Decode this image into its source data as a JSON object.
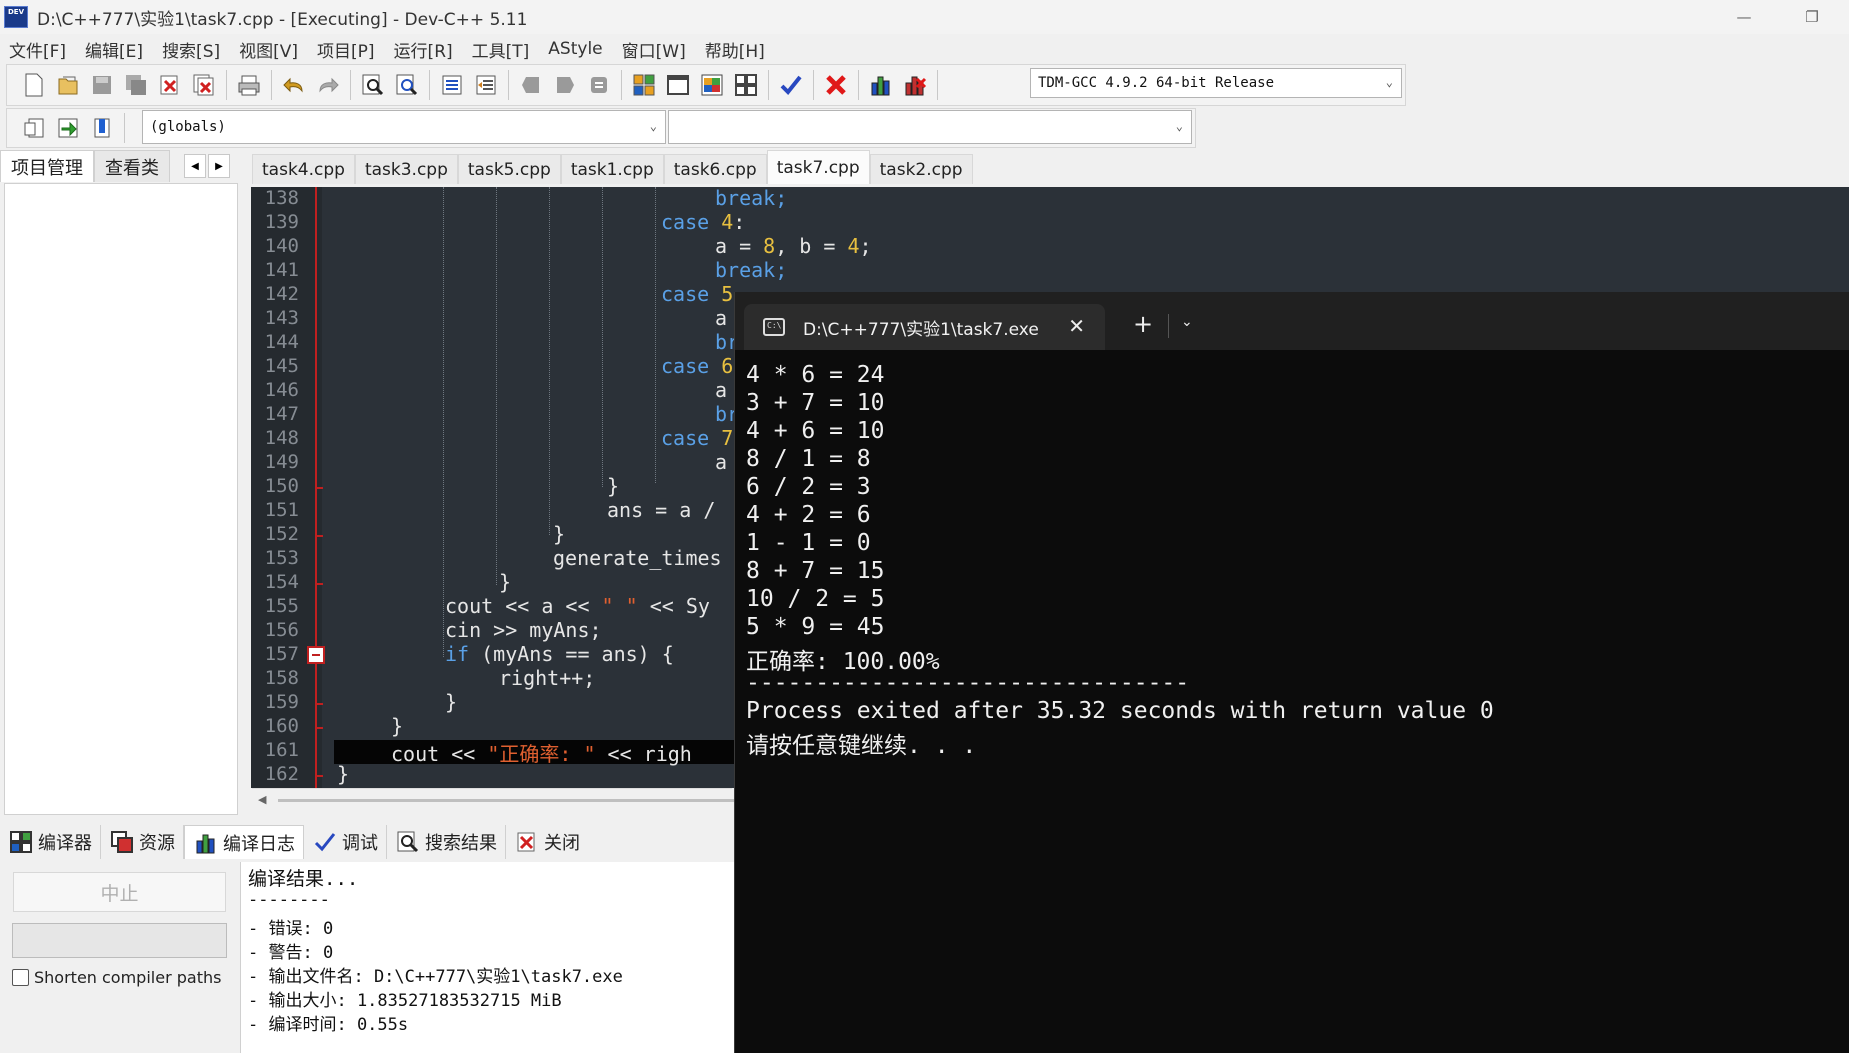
{
  "window": {
    "title": "D:\\C++777\\实验1\\task7.cpp - [Executing] - Dev-C++ 5.11",
    "app_icon_text": "DEV"
  },
  "menu": [
    "文件[F]",
    "编辑[E]",
    "搜索[S]",
    "视图[V]",
    "项目[P]",
    "运行[R]",
    "工具[T]",
    "AStyle",
    "窗口[W]",
    "帮助[H]"
  ],
  "toolbar": {
    "compiler_select": "TDM-GCC 4.9.2 64-bit Release",
    "scope_select": "(globals)",
    "symbol_select": ""
  },
  "left_panel": {
    "tabs": [
      "项目管理",
      "查看类"
    ]
  },
  "editor_tabs": [
    "task4.cpp",
    "task3.cpp",
    "task5.cpp",
    "task1.cpp",
    "task6.cpp",
    "task7.cpp",
    "task2.cpp"
  ],
  "active_editor_tab": "task7.cpp",
  "code_lines": [
    {
      "n": "138",
      "text": "break;"
    },
    {
      "n": "139",
      "text": "case 4:"
    },
    {
      "n": "140",
      "text": "a = 8, b = 4;"
    },
    {
      "n": "141",
      "text": "break;"
    },
    {
      "n": "142",
      "text": "case 5"
    },
    {
      "n": "143",
      "text": "a"
    },
    {
      "n": "144",
      "text": "br"
    },
    {
      "n": "145",
      "text": "case 6"
    },
    {
      "n": "146",
      "text": "a"
    },
    {
      "n": "147",
      "text": "br"
    },
    {
      "n": "148",
      "text": "case 7"
    },
    {
      "n": "149",
      "text": "a"
    },
    {
      "n": "150",
      "text": "}"
    },
    {
      "n": "151",
      "text": "ans = a /"
    },
    {
      "n": "152",
      "text": "}"
    },
    {
      "n": "153",
      "text": "generate_times"
    },
    {
      "n": "154",
      "text": "}"
    },
    {
      "n": "155",
      "text": "cout << a << \" \" << Sy"
    },
    {
      "n": "156",
      "text": "cin >> myAns;"
    },
    {
      "n": "157",
      "text": "if (myAns == ans) {"
    },
    {
      "n": "158",
      "text": "right++;"
    },
    {
      "n": "159",
      "text": "}"
    },
    {
      "n": "160",
      "text": "}"
    },
    {
      "n": "161",
      "text": "cout << \"正确率: \" << righ"
    },
    {
      "n": "162",
      "text": "}"
    }
  ],
  "bottom_tabs": [
    "编译器",
    "资源",
    "编译日志",
    "调试",
    "搜索结果",
    "关闭"
  ],
  "bottom_left": {
    "stop_button": "中止",
    "shorten_paths_label": "Shorten compiler paths"
  },
  "compile_log": [
    "编译结果...",
    "--------",
    "- 错误: 0",
    "- 警告: 0",
    "- 输出文件名: D:\\C++777\\实验1\\task7.exe",
    "- 输出大小: 1.83527183532715 MiB",
    "- 编译时间: 0.55s"
  ],
  "terminal": {
    "tab_title": "D:\\C++777\\实验1\\task7.exe",
    "lines": [
      "4 * 6 = 24",
      "3 + 7 = 10",
      "4 + 6 = 10",
      "8 / 1 = 8",
      "6 / 2 = 3",
      "4 + 2 = 6",
      "1 - 1 = 0",
      "8 + 7 = 15",
      "10 / 2 = 5",
      "5 * 9 = 45",
      "正确率: 100.00%",
      "--------------------------------",
      "Process exited after 35.32 seconds with return value 0",
      "请按任意键继续. . ."
    ]
  },
  "colors": {
    "editor_bg": "#2b3138",
    "keyword": "#5aa0e6",
    "number": "#e8c040",
    "string": "#e06030",
    "terminal_bg": "#0c0c0c"
  }
}
